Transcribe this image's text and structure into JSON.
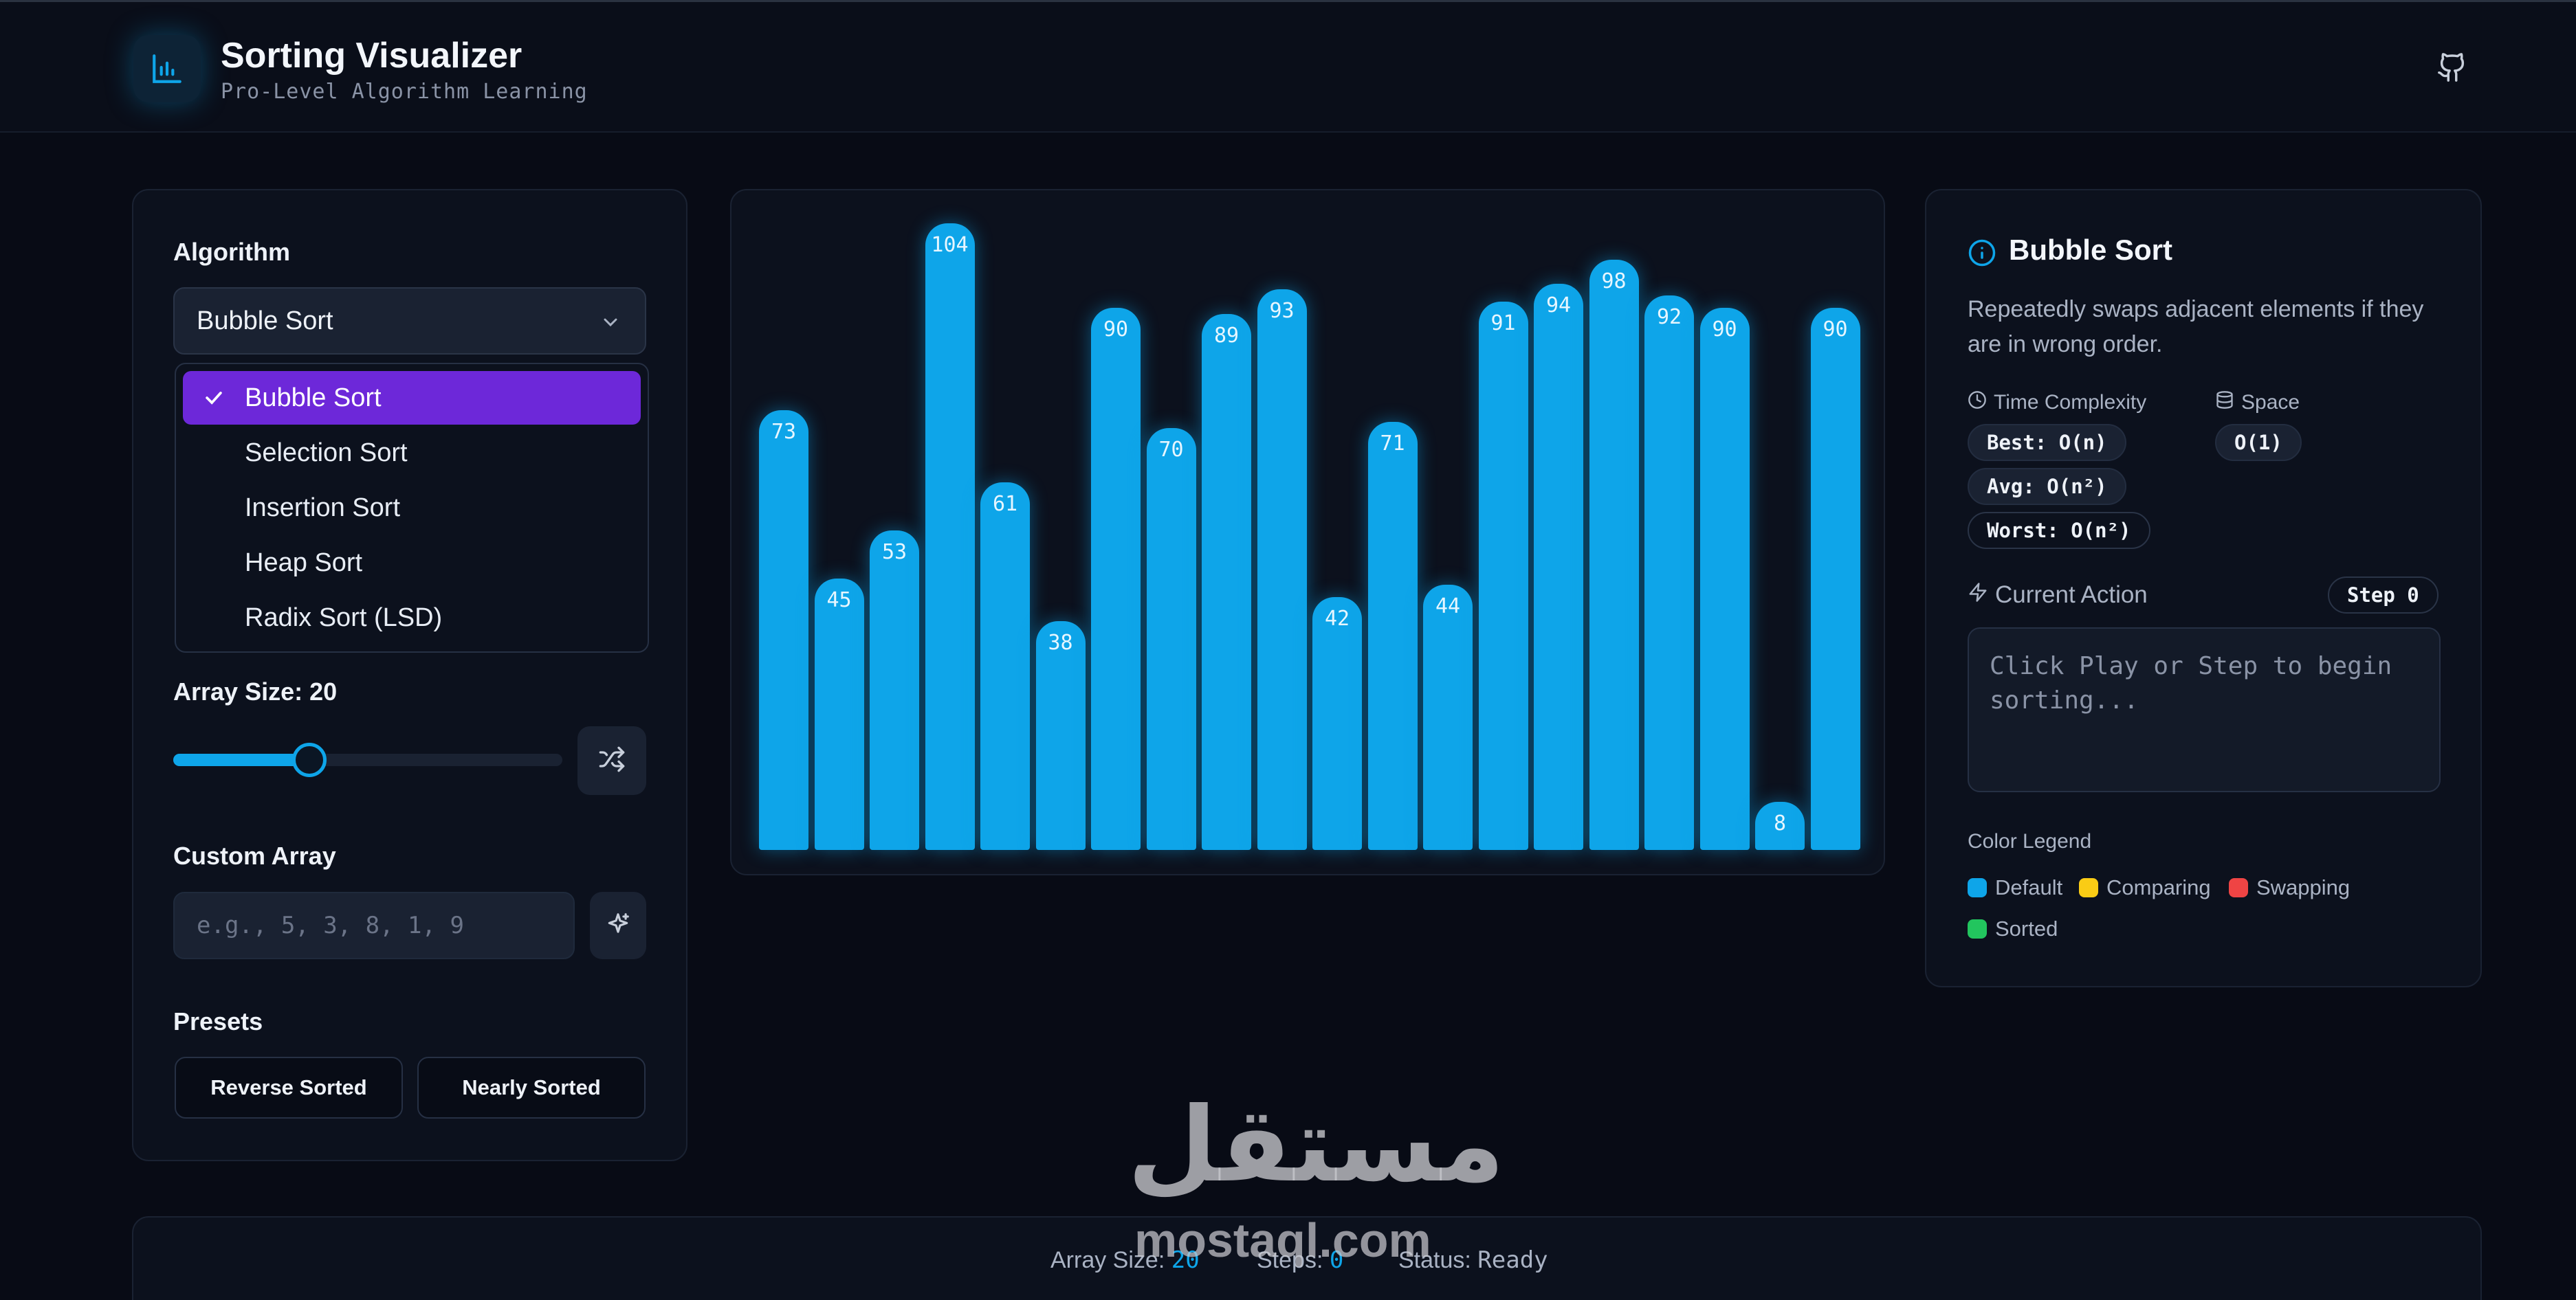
{
  "header": {
    "title": "Sorting Visualizer",
    "subtitle": "Pro-Level Algorithm Learning"
  },
  "controls": {
    "algorithm_label": "Algorithm",
    "selected_algorithm": "Bubble Sort",
    "algorithms": [
      "Bubble Sort",
      "Selection Sort",
      "Insertion Sort",
      "Heap Sort",
      "Radix Sort (LSD)"
    ],
    "array_size_label": "Array Size: 20",
    "array_size_value": 20,
    "array_size_fraction": 0.35,
    "custom_array_label": "Custom Array",
    "custom_array_placeholder": "e.g., 5, 3, 8, 1, 9",
    "presets_label": "Presets",
    "presets": [
      "Reverse Sorted",
      "Nearly Sorted"
    ]
  },
  "chart_data": {
    "type": "bar",
    "values": [
      73,
      45,
      53,
      104,
      61,
      38,
      90,
      70,
      89,
      93,
      42,
      71,
      44,
      91,
      94,
      98,
      92,
      90,
      8,
      90
    ],
    "ylim": [
      0,
      104
    ],
    "bar_color": "#0ea5e9"
  },
  "info": {
    "title": "Bubble Sort",
    "description": "Repeatedly swaps adjacent elements if they are in wrong order.",
    "time_label": "Time Complexity",
    "space_label": "Space",
    "best": "Best: O(n)",
    "avg": "Avg: O(n²)",
    "worst": "Worst: O(n²)",
    "space": "O(1)",
    "current_action_label": "Current Action",
    "step_badge": "Step 0",
    "action_text": "Click Play or Step to begin sorting...",
    "legend_title": "Color Legend",
    "legend": [
      {
        "label": "Default",
        "color": "#0ea5e9"
      },
      {
        "label": "Comparing",
        "color": "#facc15"
      },
      {
        "label": "Swapping",
        "color": "#ef4444"
      },
      {
        "label": "Sorted",
        "color": "#22c55e"
      }
    ]
  },
  "status": {
    "array_size_label": "Array Size:",
    "array_size": "20",
    "steps_label": "Steps:",
    "steps": "0",
    "status_label": "Status:",
    "status": "Ready"
  },
  "watermark": {
    "arabic": "مستقل",
    "latin": "mostaql.com"
  }
}
